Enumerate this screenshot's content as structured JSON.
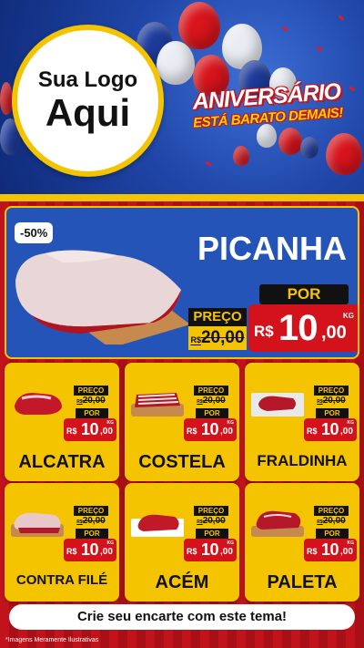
{
  "header": {
    "logo_line1": "Sua Logo",
    "logo_line2": "Aqui",
    "title_line1": "ANIVERSÁRIO",
    "title_line2": "ESTÁ BARATO DEMAIS!"
  },
  "featured": {
    "discount_badge": "-50%",
    "name": "PICANHA",
    "price_label": "PREÇO",
    "old_price_currency": "R$",
    "old_price": "20,00",
    "por_label": "POR",
    "currency": "R$",
    "price_int": "10",
    "price_dec": ",00",
    "unit": "KG"
  },
  "products": [
    {
      "name": "ALCATRA",
      "price_label": "PREÇO",
      "old_price_currency": "R$",
      "old_price": "20,00",
      "por_label": "POR",
      "currency": "R$",
      "price_int": "10",
      "price_dec": ",00",
      "unit": "KG"
    },
    {
      "name": "COSTELA",
      "price_label": "PREÇO",
      "old_price_currency": "R$",
      "old_price": "20,00",
      "por_label": "POR",
      "currency": "R$",
      "price_int": "10",
      "price_dec": ",00",
      "unit": "KG"
    },
    {
      "name": "FRALDINHA",
      "price_label": "PREÇO",
      "old_price_currency": "R$",
      "old_price": "20,00",
      "por_label": "POR",
      "currency": "R$",
      "price_int": "10",
      "price_dec": ",00",
      "unit": "KG"
    },
    {
      "name": "CONTRA FILÉ",
      "price_label": "PREÇO",
      "old_price_currency": "R$",
      "old_price": "20,00",
      "por_label": "POR",
      "currency": "R$",
      "price_int": "10",
      "price_dec": ",00",
      "unit": "KG"
    },
    {
      "name": "ACÉM",
      "price_label": "PREÇO",
      "old_price_currency": "R$",
      "old_price": "20,00",
      "por_label": "POR",
      "currency": "R$",
      "price_int": "10",
      "price_dec": ",00",
      "unit": "KG"
    },
    {
      "name": "PALETA",
      "price_label": "PREÇO",
      "old_price_currency": "R$",
      "old_price": "20,00",
      "por_label": "POR",
      "currency": "R$",
      "price_int": "10",
      "price_dec": ",00",
      "unit": "KG"
    }
  ],
  "footer": {
    "cta": "Crie seu encarte com este tema!",
    "disclaimer": "*Imagens Meramente Ilustrativas"
  },
  "colors": {
    "red": "#d3121b",
    "yellow": "#f5c400",
    "blue": "#2454b8",
    "black": "#111111"
  }
}
